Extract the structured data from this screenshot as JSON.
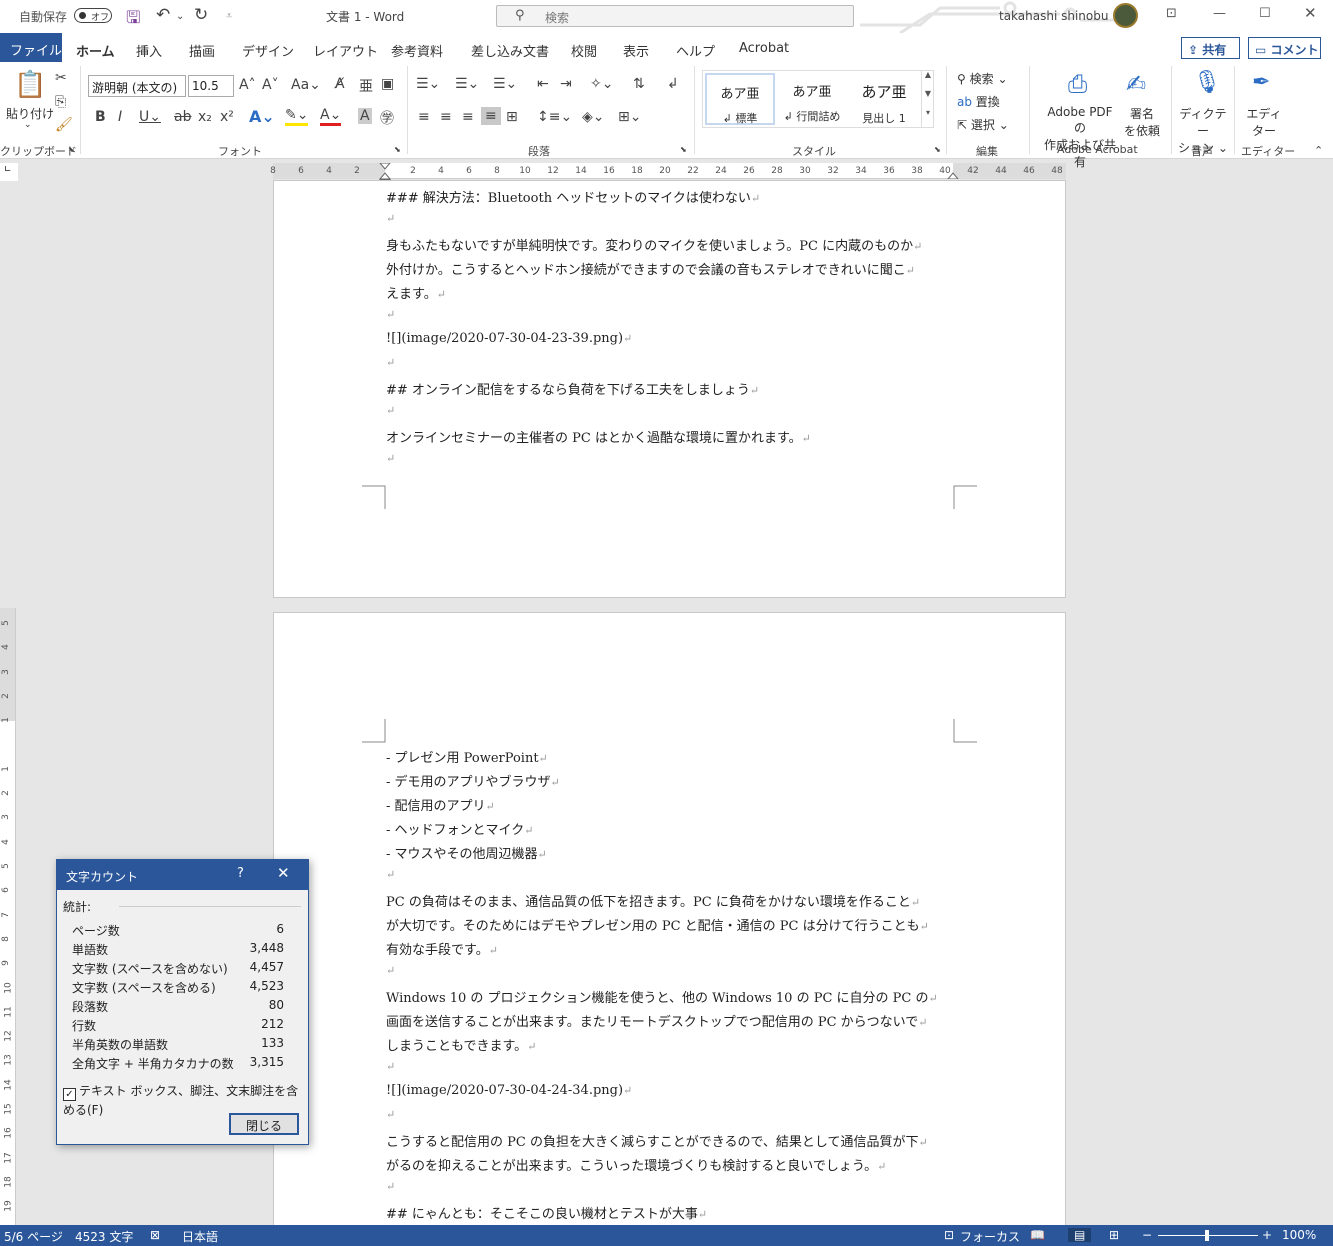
{
  "titlebar": {
    "autosave_label": "自動保存",
    "autosave_state": "オフ",
    "doc_title": "文書 1  -  Word",
    "search_placeholder": "検索",
    "user_name": "takahashi shinobu"
  },
  "tabs": {
    "file": "ファイル",
    "items": [
      "ホーム",
      "挿入",
      "描画",
      "デザイン",
      "レイアウト",
      "参考資料",
      "差し込み文書",
      "校閲",
      "表示",
      "ヘルプ",
      "Acrobat"
    ],
    "share": "共有",
    "comment": "コメント"
  },
  "ribbon": {
    "paste_label": "貼り付け",
    "font_name": "游明朝 (本文の)",
    "font_size": "10.5",
    "groups": {
      "clipboard": "クリップボード",
      "font": "フォント",
      "paragraph": "段落",
      "styles": "スタイル",
      "editing": "編集",
      "acrobat": "Adobe Acrobat",
      "voice": "音声",
      "editor": "エディター"
    },
    "styles": [
      {
        "sample": "あア亜",
        "name": "↲ 標準"
      },
      {
        "sample": "あア亜",
        "name": "↲ 行間詰め"
      },
      {
        "sample": "あア亜",
        "name": "見出し 1"
      }
    ],
    "editing": {
      "find": "検索",
      "replace": "置換",
      "select": "選択"
    },
    "acrobat": {
      "create_line1": "Adobe PDF の",
      "create_line2": "作成および共有",
      "sign_line1": "署名",
      "sign_line2": "を依頼"
    },
    "dictate_line1": "ディクテー",
    "dictate_line2": "ション",
    "editor_line1": "エディ",
    "editor_line2": "ター"
  },
  "ruler": {
    "numbers": [
      "8",
      "6",
      "4",
      "2",
      "",
      "2",
      "4",
      "6",
      "8",
      "10",
      "12",
      "14",
      "16",
      "18",
      "20",
      "22",
      "24",
      "26",
      "28",
      "30",
      "32",
      "34",
      "36",
      "38",
      "40",
      "42",
      "44",
      "46",
      "48"
    ],
    "vnumbers": [
      "5",
      "4",
      "3",
      "2",
      "1",
      "",
      "1",
      "2",
      "3",
      "4",
      "5",
      "6",
      "7",
      "8",
      "9",
      "10",
      "11",
      "12",
      "13",
      "14",
      "15",
      "16",
      "17",
      "18",
      "19"
    ]
  },
  "doc": {
    "page1": [
      {
        "text": "### 解決方法：Bluetooth ヘッドセットのマイクは使わない"
      },
      {
        "text": ""
      },
      {
        "text": "身もふたもないですが単純明快です。変わりのマイクを使いましょう。PC に内蔵のものか"
      },
      {
        "text": "外付けか。こうするとヘッドホン接続ができますので会議の音もステレオできれいに聞こ"
      },
      {
        "text": "えます。"
      },
      {
        "text": ""
      },
      {
        "text": "![](image/2020-07-30-04-23-39.png)"
      },
      {
        "text": ""
      },
      {
        "text": "## オンライン配信をするなら負荷を下げる工夫をしましょう"
      },
      {
        "text": ""
      },
      {
        "text": "オンラインセミナーの主催者の PC はとかく過酷な環境に置かれます。"
      },
      {
        "text": ""
      }
    ],
    "page2": [
      {
        "text": "- プレゼン用 PowerPoint"
      },
      {
        "text": "- デモ用のアプリやブラウザ"
      },
      {
        "text": "- 配信用のアプリ"
      },
      {
        "text": "- ヘッドフォンとマイク"
      },
      {
        "text": "- マウスやその他周辺機器"
      },
      {
        "text": ""
      },
      {
        "text": "PC の負荷はそのまま、通信品質の低下を招きます。PC に負荷をかけない環境を作ること"
      },
      {
        "text": "が大切です。そのためにはデモやプレゼン用の PC と配信・通信の PC は分けて行うことも"
      },
      {
        "text": "有効な手段です。"
      },
      {
        "text": ""
      },
      {
        "text": "Windows 10 の プロジェクション機能を使うと、他の Windows 10 の PC に自分の PC の"
      },
      {
        "text": "画面を送信することが出来ます。またリモートデスクトップでつ配信用の PC からつないで"
      },
      {
        "text": "しまうこともできます。"
      },
      {
        "text": ""
      },
      {
        "text": "![](image/2020-07-30-04-24-34.png)"
      },
      {
        "text": ""
      },
      {
        "text": "こうすると配信用の PC の負担を大きく減らすことができるので、結果として通信品質が下"
      },
      {
        "text": "がるのを抑えることが出来ます。こういった環境づくりも検討すると良いでしょう。"
      },
      {
        "text": ""
      },
      {
        "text": "## にゃんとも：そこそこの良い機材とテストが大事"
      }
    ]
  },
  "dialog": {
    "title": "文字カウント",
    "help": "?",
    "stats_label": "統計:",
    "rows": [
      {
        "label": "ページ数",
        "value": "6"
      },
      {
        "label": "単語数",
        "value": "3,448"
      },
      {
        "label": "文字数 (スペースを含めない)",
        "value": "4,457"
      },
      {
        "label": "文字数 (スペースを含める)",
        "value": "4,523"
      },
      {
        "label": "段落数",
        "value": "80"
      },
      {
        "label": "行数",
        "value": "212"
      },
      {
        "label": "半角英数の単語数",
        "value": "133"
      },
      {
        "label": "全角文字 + 半角カタカナの数",
        "value": "3,315"
      }
    ],
    "include_label": "テキスト ボックス、脚注、文末脚注を含める(F)",
    "include_checked": true,
    "close_label": "閉じる"
  },
  "statusbar": {
    "page": "5/6 ページ",
    "words": "4523 文字",
    "language": "日本語",
    "focus": "フォーカス",
    "zoom": "100%",
    "zoom_level": 1.0
  },
  "colors": {
    "accent": "#2b579a",
    "ribbon_bg": "#ffffff",
    "canvas_bg": "#e6e6e6"
  }
}
